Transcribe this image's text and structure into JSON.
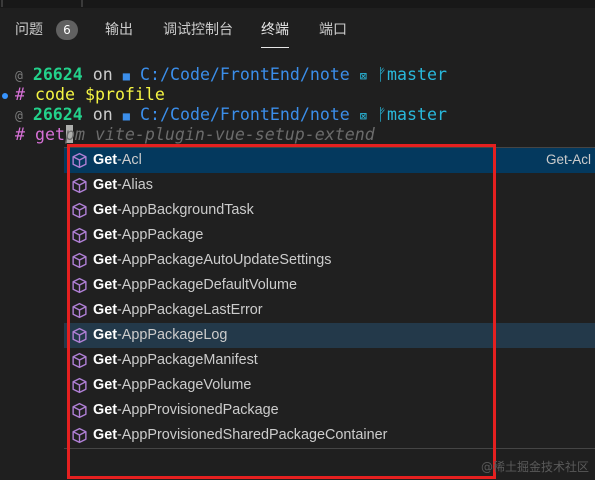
{
  "panel_tabs": [
    {
      "label": "问题",
      "active": false
    },
    {
      "label": "输出",
      "active": false
    },
    {
      "label": "调试控制台",
      "active": false
    },
    {
      "label": "终端",
      "active": true
    },
    {
      "label": "端口",
      "active": false
    }
  ],
  "problems_count": "6",
  "terminal": {
    "lines": [
      {
        "prompt": "@",
        "pid": "26624",
        "on": "on",
        "folder": "■",
        "path": "C:/Code/FrontEnd/note",
        "git": "⊠",
        "branch_icon": "ᚠ",
        "branch": "master"
      },
      {
        "hash": "#",
        "cmd": "code",
        "arg": "$profile"
      },
      {
        "prompt": "@",
        "pid": "26624",
        "on": "on",
        "folder": "■",
        "path": "C:/Code/FrontEnd/note",
        "git": "⊠",
        "branch_icon": "ᚠ",
        "branch": "master"
      },
      {
        "hash": "#",
        "typed": "get",
        "ghost": "pm vite-plugin-vue-setup-extend"
      }
    ]
  },
  "suggestions": {
    "match_prefix": "Get",
    "items": [
      {
        "rest": "-Acl",
        "detail": "Get-Acl",
        "state": "selected"
      },
      {
        "rest": "-Alias"
      },
      {
        "rest": "-AppBackgroundTask"
      },
      {
        "rest": "-AppPackage"
      },
      {
        "rest": "-AppPackageAutoUpdateSettings"
      },
      {
        "rest": "-AppPackageDefaultVolume"
      },
      {
        "rest": "-AppPackageLastError"
      },
      {
        "rest": "-AppPackageLog",
        "state": "hover"
      },
      {
        "rest": "-AppPackageManifest"
      },
      {
        "rest": "-AppPackageVolume"
      },
      {
        "rest": "-AppProvisionedPackage"
      },
      {
        "rest": "-AppProvisionedSharedPackageContainer"
      }
    ],
    "icon": "method-cube-icon",
    "icon_color": "#b180d7"
  },
  "watermark": "@稀土掘金技术社区"
}
